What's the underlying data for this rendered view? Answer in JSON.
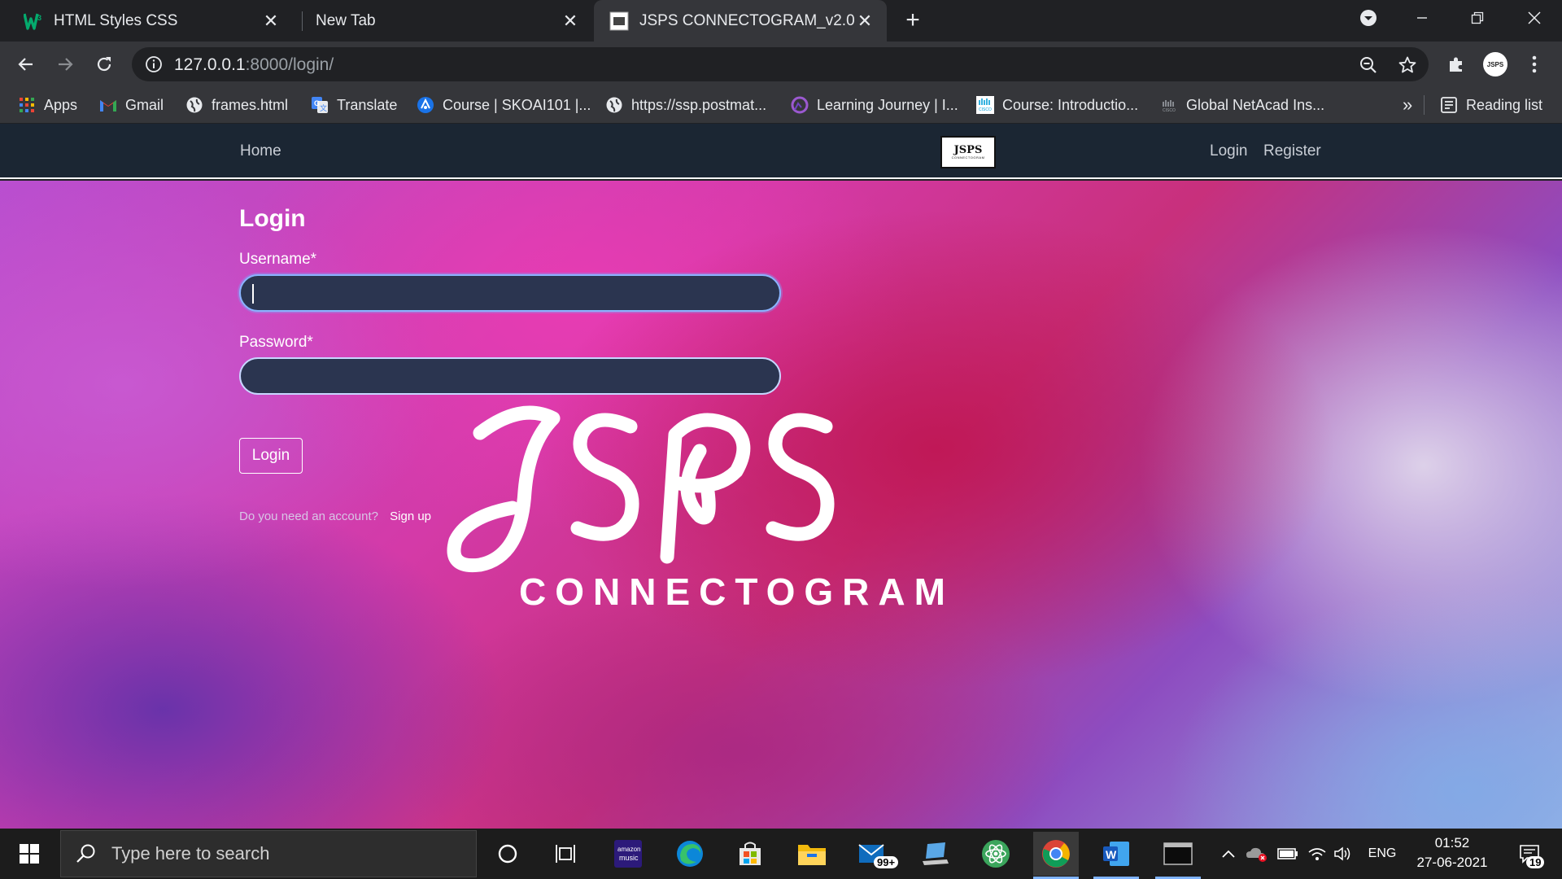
{
  "browser": {
    "tabs": [
      {
        "title": "HTML Styles CSS",
        "favicon": "w3schools-icon",
        "active": false
      },
      {
        "title": "New Tab",
        "favicon": "",
        "active": false
      },
      {
        "title": "JSPS CONNECTOGRAM_v2.0",
        "favicon": "site-logo-icon",
        "active": true
      }
    ],
    "url": {
      "host": "127.0.0.1",
      "path": ":8000/login/"
    },
    "bookmarks": [
      {
        "label": "Apps",
        "icon": "apps-grid-icon"
      },
      {
        "label": "Gmail",
        "icon": "gmail-icon"
      },
      {
        "label": "frames.html",
        "icon": "globe-icon"
      },
      {
        "label": "Translate",
        "icon": "translate-icon"
      },
      {
        "label": "Course | SKOAI101 |...",
        "icon": "course-icon"
      },
      {
        "label": "https://ssp.postmat...",
        "icon": "globe-icon"
      },
      {
        "label": "Learning Journey | I...",
        "icon": "learning-icon"
      },
      {
        "label": "Course: Introductio...",
        "icon": "cisco-icon"
      },
      {
        "label": "Global NetAcad Ins...",
        "icon": "cisco-icon"
      }
    ],
    "overflow": "»",
    "reading_list": "Reading list",
    "avatar_text": "JSPS"
  },
  "site": {
    "nav": {
      "home": "Home",
      "login": "Login",
      "register": "Register"
    },
    "logo": {
      "main": "JSPS",
      "sub": "CONNECTOGRAM"
    },
    "form": {
      "title": "Login",
      "username_label": "Username*",
      "username_value": "",
      "password_label": "Password*",
      "password_value": "",
      "submit": "Login",
      "signup_prompt": "Do you need an account?",
      "signup_link": "Sign up"
    },
    "brand": {
      "main": "JSPS",
      "sub": "CONNECTOGRAM"
    }
  },
  "taskbar": {
    "search_placeholder": "Type here to search",
    "mail_badge": "99+",
    "language": "ENG",
    "time": "01:52",
    "date": "27-06-2021",
    "notifications": "19",
    "amazon_music_label": "amazon music"
  }
}
